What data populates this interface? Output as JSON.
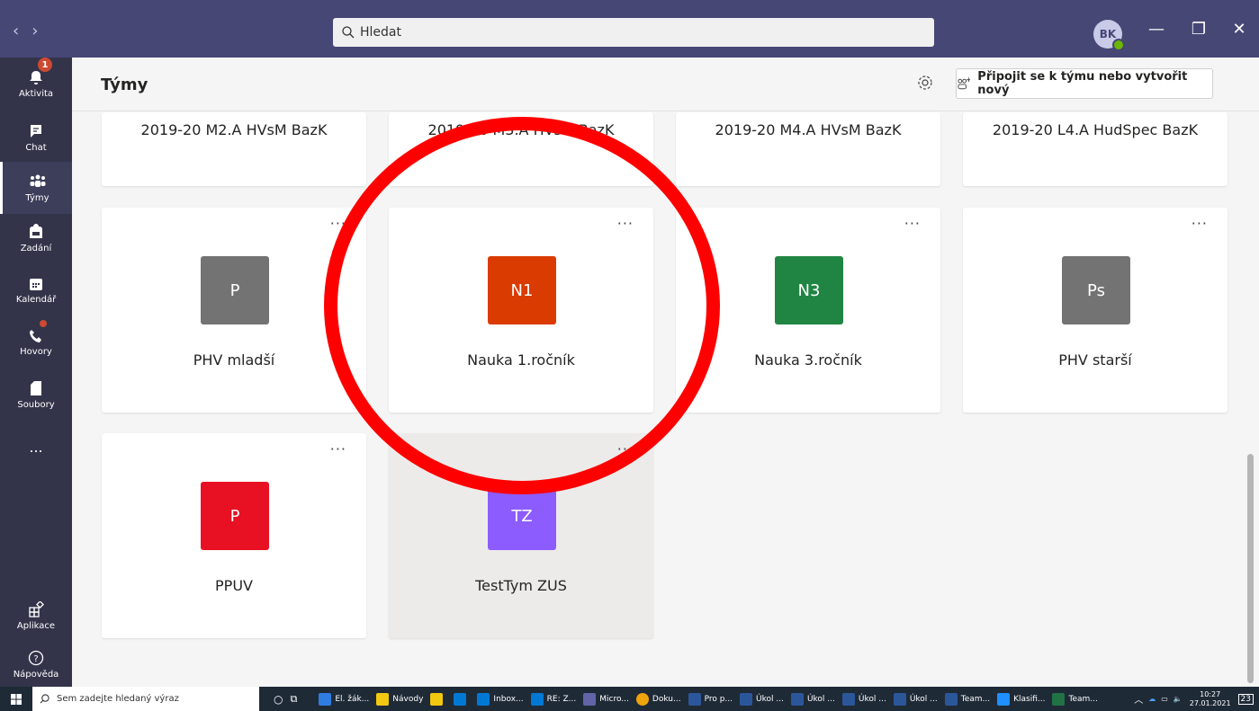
{
  "titlebar": {
    "search_placeholder": "Hledat",
    "avatar_initials": "BK"
  },
  "rail": {
    "items": [
      {
        "label": "Aktivita",
        "badge": "1"
      },
      {
        "label": "Chat"
      },
      {
        "label": "Týmy"
      },
      {
        "label": "Zadání"
      },
      {
        "label": "Kalendář"
      },
      {
        "label": "Hovory"
      },
      {
        "label": "Soubory"
      },
      {
        "label": "..."
      },
      {
        "label": "Aplikace"
      },
      {
        "label": "Nápověda"
      }
    ]
  },
  "header": {
    "title": "Týmy",
    "join_label": "Připojit se k týmu nebo vytvořit nový"
  },
  "teams": [
    {
      "name": "2019-20 M2.A HVsM BazK"
    },
    {
      "name": "2019-20 M3.A HVsM BazK"
    },
    {
      "name": "2019-20 M4.A HVsM BazK"
    },
    {
      "name": "2019-20 L4.A HudSpec BazK"
    },
    {
      "name": "PHV mladší",
      "initials": "P",
      "color": "#737373"
    },
    {
      "name": "Nauka 1.ročník",
      "initials": "N1",
      "color": "#da3b01"
    },
    {
      "name": "Nauka 3.ročník",
      "initials": "N3",
      "color": "#208543"
    },
    {
      "name": "PHV starší",
      "initials": "Ps",
      "color": "#737373"
    },
    {
      "name": "PPUV",
      "initials": "P",
      "color": "#e81123"
    },
    {
      "name": "TestTym ZUS",
      "initials": "TZ",
      "color": "#8c5cff"
    }
  ],
  "card_more": "···",
  "annotation_color": "#ff0000",
  "taskbar": {
    "search_placeholder": "Sem zadejte hledaný výraz",
    "apps": [
      {
        "label": "El. žák...",
        "color": "#2f7de1"
      },
      {
        "label": "Návody",
        "color": "#f2c811"
      },
      {
        "label": "",
        "color": "#f2c811"
      },
      {
        "label": "",
        "color": "#0078d4"
      },
      {
        "label": "Inbox...",
        "color": "#0078d4"
      },
      {
        "label": "RE: Z...",
        "color": "#0078d4"
      },
      {
        "label": "Micro...",
        "color": "#6264a7"
      },
      {
        "label": "Doku...",
        "color": "#f0a30a"
      },
      {
        "label": "Pro p...",
        "color": "#2b579a"
      },
      {
        "label": "Úkol ...",
        "color": "#2b579a"
      },
      {
        "label": "Úkol ...",
        "color": "#2b579a"
      },
      {
        "label": "Úkol ...",
        "color": "#2b579a"
      },
      {
        "label": "Úkol ...",
        "color": "#2b579a"
      },
      {
        "label": "Team...",
        "color": "#2b579a"
      },
      {
        "label": "Klasifi...",
        "color": "#1e90ff"
      },
      {
        "label": "Team...",
        "color": "#217346"
      }
    ],
    "time": "10:27",
    "date": "27.01.2021",
    "notifications": "23"
  }
}
